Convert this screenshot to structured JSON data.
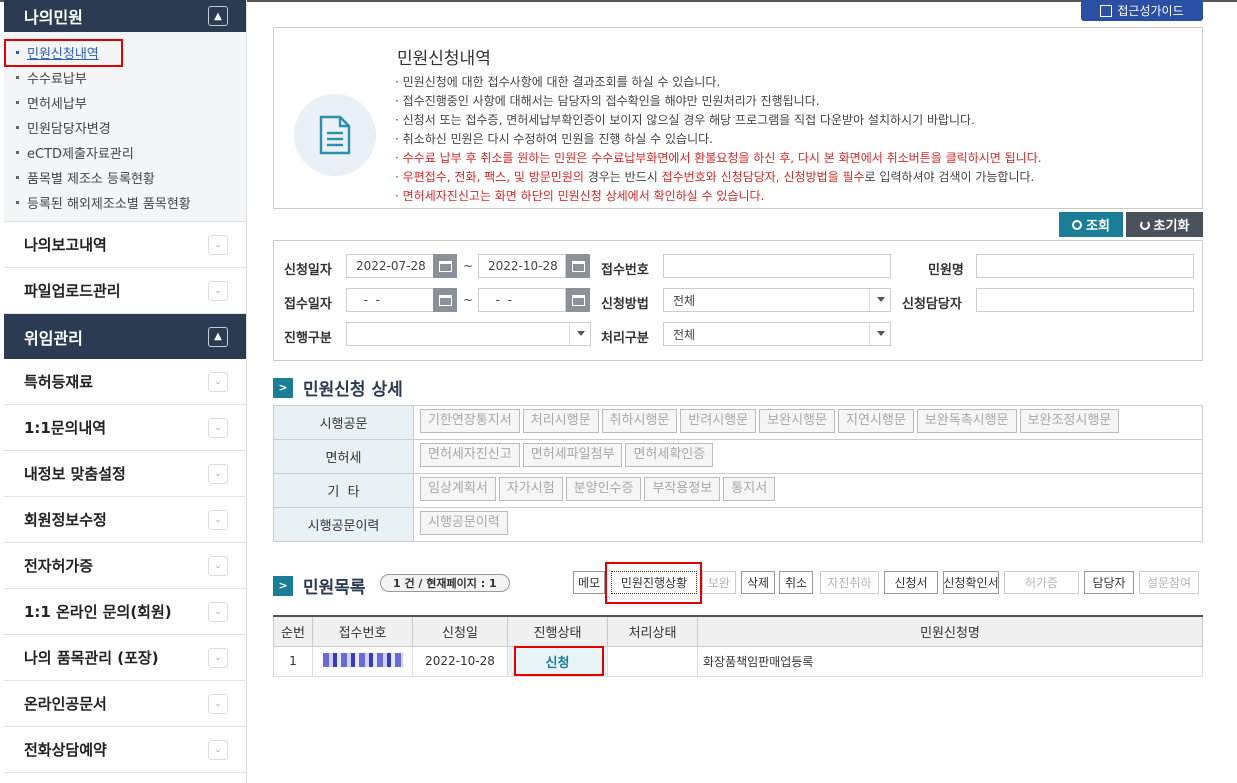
{
  "sidebar": {
    "my_complaints": {
      "title": "나의민원",
      "toggle": "▲"
    },
    "sub_items": [
      {
        "label": "민원신청내역",
        "active": true
      },
      {
        "label": "수수료납부"
      },
      {
        "label": "면허세납부"
      },
      {
        "label": "민원담당자변경"
      },
      {
        "label": "eCTD제출자료관리"
      },
      {
        "label": "품목별 제조소 등록현황"
      },
      {
        "label": "등록된 해외제조소별 품목현황"
      }
    ],
    "menu_a": [
      {
        "label": "나의보고내역",
        "toggle": "⌄"
      },
      {
        "label": "파일업로드관리",
        "toggle": "⌄"
      }
    ],
    "delegation": {
      "title": "위임관리",
      "toggle": "▲"
    },
    "menu_b": [
      {
        "label": "특허등재료",
        "toggle": "⌄"
      },
      {
        "label": "1:1문의내역",
        "toggle": "⌄"
      },
      {
        "label": "내정보 맞춤설정",
        "toggle": "⌄"
      },
      {
        "label": "회원정보수정",
        "toggle": "⌄"
      },
      {
        "label": "전자허가증",
        "toggle": "⌄"
      },
      {
        "label": "1:1 온라인 문의(회원)",
        "toggle": "⌄"
      },
      {
        "label": "나의 품목관리 (포장)",
        "toggle": "⌄"
      },
      {
        "label": "온라인공문서",
        "toggle": "⌄"
      },
      {
        "label": "전화상담예약",
        "toggle": "⌄"
      }
    ]
  },
  "guide_button": "접근성가이드",
  "info": {
    "title": "민원신청내역",
    "lines": [
      "· 민원신청에 대한 접수사항에 대한 결과조회를 하실 수 있습니다.",
      "· 접수진행중인 사항에 대해서는 담당자의 접수확인을 해야만 민원처리가 진행됩니다.",
      "· 신청서 또는 접수증, 면허세납부확인증이 보이지 않으실 경우 해당 프로그램을 직접 다운받아 설치하시기 바랍니다.",
      "· 취소하신 민원은 다시 수정하여 민원을 진행 하실 수 있습니다.",
      "· 수수료 납부 후 취소를 원하는 민원은 수수료납부화면에서 환불요청을 하신 후, 다시 본 화면에서 취소버튼을 클릭하시면 됩니다."
    ],
    "mixed_line": {
      "p1": "· ",
      "p2": "우편접수, 전화, 팩스, 및 방문민원의",
      "p3": " 경우는 반드시 ",
      "p4": "접수번호와 신청담당자, 신청방법을 필수",
      "p5": "로 입력하셔야 검색이 가능합니다."
    },
    "last_line": "· 면허세자진신고는 화면 하단의 민원신청 상세에서 확인하실 수 있습니다."
  },
  "buttons": {
    "search": "조회",
    "reset": "초기화"
  },
  "filters": {
    "apply_date_label": "신청일자",
    "apply_from": "2022-07-28",
    "apply_to": "2022-10-28",
    "tilde": "~",
    "receipt_no_label": "접수번호",
    "receipt_no": "",
    "complaint_name_label": "민원명",
    "complaint_name": "",
    "receive_date_label": "접수일자",
    "receive_from": "  -  -",
    "receive_to": "  -  -",
    "method_label": "신청방법",
    "method_value": "전체",
    "manager_label": "신청담당자",
    "manager": "",
    "progress_label": "진행구분",
    "progress_value": "",
    "process_label": "처리구분",
    "process_value": "전체"
  },
  "detail": {
    "title": "민원신청 상세",
    "rows": [
      {
        "label": "시행공문",
        "buttons": [
          "기한연장통지서",
          "처리시행문",
          "취하시행문",
          "반려시행문",
          "보완시행문",
          "지연시행문",
          "보완독촉시행문",
          "보완조정시행문"
        ]
      },
      {
        "label": "면허세",
        "buttons": [
          "면허세자진신고",
          "면허세파일첨부",
          "면허세확인증"
        ]
      },
      {
        "label": "기  타",
        "buttons": [
          "임상계획서",
          "자가시험",
          "분양인수증",
          "부작용정보",
          "통지서"
        ]
      },
      {
        "label": "시행공문이력",
        "buttons": [
          "시행공문이력"
        ]
      }
    ]
  },
  "list": {
    "title": "민원목록",
    "count": "1 건 / 현재페이지 : 1",
    "actions": {
      "memo": "메모",
      "progress": "민원진행상황",
      "supplement": "보완",
      "delete": "삭제",
      "cancel": "취소",
      "self_withdraw": "자진취하",
      "application": "신청서",
      "apply_confirm": "신청확인서",
      "license": "허가증",
      "manager": "담당자",
      "survey": "설문참여"
    },
    "headers": [
      "순번",
      "접수번호",
      "신청일",
      "진행상태",
      "처리상태",
      "민원신청명"
    ],
    "rows": [
      {
        "no": "1",
        "receipt_no": "",
        "apply_date": "2022-10-28",
        "progress": "신청",
        "process": "",
        "name": "화장품책임판매업등록"
      }
    ]
  }
}
